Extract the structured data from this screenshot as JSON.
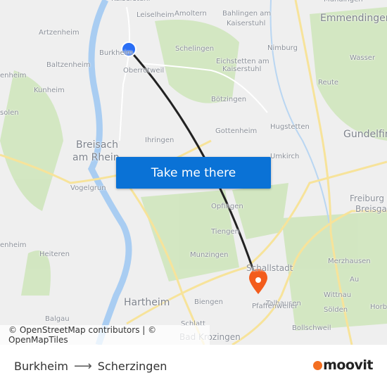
{
  "map": {
    "labels": [
      "Kaiserstuhl",
      "Leiselheim",
      "Amoltern",
      "Bahlingen am",
      "Kaiserstuhl",
      "Mundingen",
      "Emmendingen",
      "Artzenheim",
      "Burkheim",
      "Schelingen",
      "Nimburg",
      "Baltzenheim",
      "Oberrotweil",
      "Eichstetten am",
      "Kaiserstuhl",
      "Wasser",
      "enheim",
      "Kunheim",
      "Reute",
      "solen",
      "Bötzingen",
      "Hugstetten",
      "Gottenheim",
      "Gundelfingen",
      "Breisach",
      "am Rhein",
      "Ihringen",
      "Umkirch",
      "Vogelgrun",
      "Freiburg im",
      "Breisgau",
      "Opfingen",
      "Tiengen",
      "enheim",
      "Heiteren",
      "Munzingen",
      "Merzhausen",
      "Schallstadt",
      "Au",
      "Talhausen",
      "Wittnau",
      "Hartheim",
      "Biengen",
      "Pfaffenweiler",
      "Sölden",
      "Horben",
      "Balgau",
      "Schlatt",
      "Bollschweil",
      "Bad Krozingen"
    ],
    "origin_marker_color": "#2a6ef5",
    "destination_marker_color": "#f35c1c",
    "route_color": "#222222"
  },
  "cta": {
    "label": "Take me there"
  },
  "attribution": "© OpenStreetMap contributors | © OpenMapTiles",
  "footer": {
    "from": "Burkheim",
    "arrow": "⟶",
    "to": "Scherzingen",
    "logo": "moovit"
  }
}
